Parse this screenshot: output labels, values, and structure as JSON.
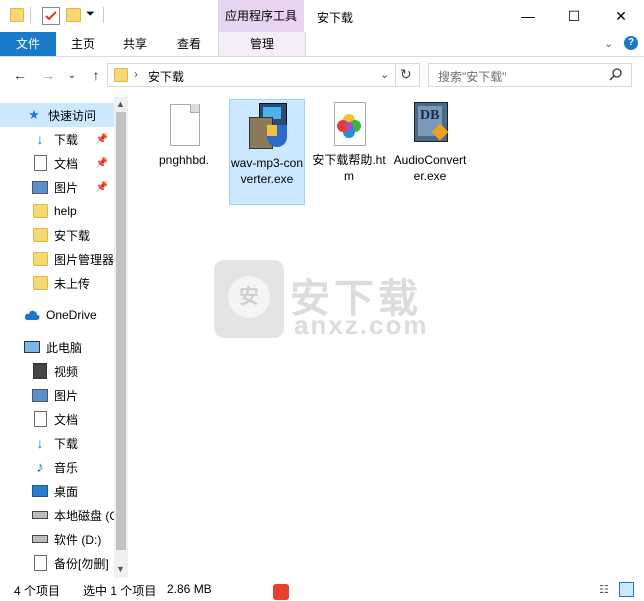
{
  "window": {
    "title": "安下载",
    "context_tab": "应用程序工具",
    "minimize": "—",
    "maximize": "☐",
    "close": "✕"
  },
  "ribbon": {
    "file": "文件",
    "home": "主页",
    "share": "共享",
    "view": "查看",
    "manage": "管理"
  },
  "address": {
    "crumb_sep": "›",
    "path": "安下载",
    "refresh": "↻",
    "search_placeholder": "搜索\"安下载\""
  },
  "sidebar": {
    "quick_access": "快速访问",
    "items": [
      {
        "label": "下载",
        "pinned": true
      },
      {
        "label": "文档",
        "pinned": true
      },
      {
        "label": "图片",
        "pinned": true
      },
      {
        "label": "help",
        "pinned": false
      },
      {
        "label": "安下载",
        "pinned": false
      },
      {
        "label": "图片管理器",
        "pinned": false
      },
      {
        "label": "未上传",
        "pinned": false
      }
    ],
    "onedrive": "OneDrive",
    "this_pc": "此电脑",
    "pc_items": [
      {
        "label": "视频"
      },
      {
        "label": "图片"
      },
      {
        "label": "文档"
      },
      {
        "label": "下载"
      },
      {
        "label": "音乐"
      },
      {
        "label": "桌面"
      },
      {
        "label": "本地磁盘 (C:)"
      },
      {
        "label": "软件 (D:)"
      },
      {
        "label": "备份[勿删]"
      }
    ]
  },
  "files": [
    {
      "name": "pnghhbd.",
      "type": "blank"
    },
    {
      "name": "wav-mp3-converter.exe",
      "type": "installer",
      "selected": true
    },
    {
      "name": "安下载帮助.htm",
      "type": "htm"
    },
    {
      "name": "AudioConverter.exe",
      "type": "audioconv"
    }
  ],
  "watermark": {
    "cn": "安下载",
    "en": "anxz.com",
    "badge": "安"
  },
  "status": {
    "count": "4 个项目",
    "selected": "选中 1 个项目",
    "size": "2.86 MB"
  },
  "colors": {
    "accent": "#1979ca",
    "selected_bg": "#cce8ff",
    "context_tab": "#e8d4f0"
  }
}
